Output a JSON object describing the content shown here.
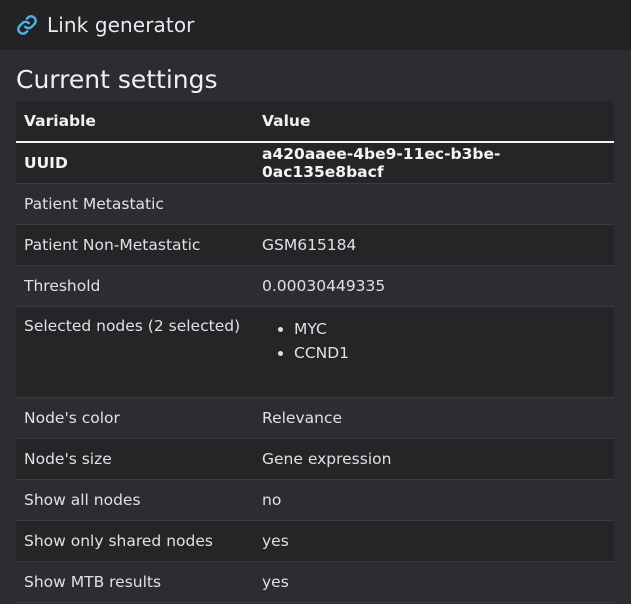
{
  "header": {
    "title": "Link generator",
    "icon": "link-icon",
    "icon_color": "#4db6e6"
  },
  "main": {
    "section_title": "Current settings",
    "table": {
      "columns": [
        "Variable",
        "Value"
      ],
      "rows": [
        {
          "variable": "UUID",
          "value": "a420aaee-4be9-11ec-b3be-0ac135e8bacf"
        },
        {
          "variable": "Patient Metastatic",
          "value": ""
        },
        {
          "variable": "Patient Non-Metastatic",
          "value": "GSM615184"
        },
        {
          "variable": "Threshold",
          "value": "0.00030449335"
        },
        {
          "variable": "Selected nodes (2 selected)",
          "values": [
            "MYC",
            "CCND1"
          ]
        },
        {
          "variable": "Node's color",
          "value": "Relevance"
        },
        {
          "variable": "Node's size",
          "value": "Gene expression"
        },
        {
          "variable": "Show all nodes",
          "value": "no"
        },
        {
          "variable": "Show only shared nodes",
          "value": "yes"
        },
        {
          "variable": "Show MTB results",
          "value": "yes"
        }
      ]
    }
  }
}
